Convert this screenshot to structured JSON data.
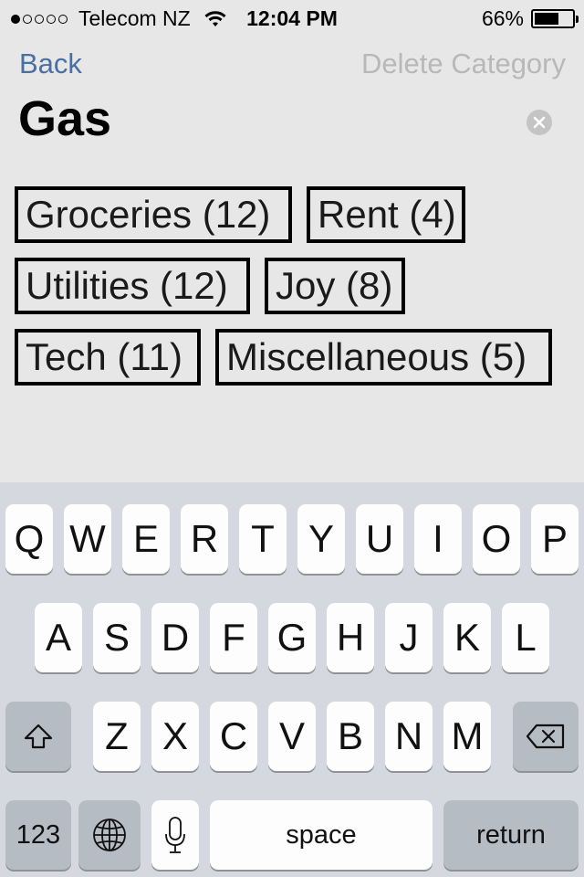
{
  "status_bar": {
    "carrier": "Telecom NZ",
    "time": "12:04 PM",
    "battery_percent": "66%",
    "battery_level": 0.66,
    "signal_bars_filled": 1,
    "signal_bars_total": 5
  },
  "nav": {
    "back_label": "Back",
    "delete_label": "Delete Category"
  },
  "category_name": {
    "value": "Gas"
  },
  "categories": [
    {
      "label": "Groceries (12)"
    },
    {
      "label": "Rent (4)"
    },
    {
      "label": "Utilities (12)"
    },
    {
      "label": "Joy (8)"
    },
    {
      "label": "Tech (11)"
    },
    {
      "label": "Miscellaneous (5)"
    }
  ],
  "keyboard": {
    "row1": [
      "Q",
      "W",
      "E",
      "R",
      "T",
      "Y",
      "U",
      "I",
      "O",
      "P"
    ],
    "row2": [
      "A",
      "S",
      "D",
      "F",
      "G",
      "H",
      "J",
      "K",
      "L"
    ],
    "row3": [
      "Z",
      "X",
      "C",
      "V",
      "B",
      "N",
      "M"
    ],
    "numbers_label": "123",
    "space_label": "space",
    "return_label": "return"
  },
  "colors": {
    "background": "#e7e7e7",
    "back_link": "#4a6fa3",
    "delete_link": "#b8b8b8",
    "keyboard_bg": "#d5d9df"
  },
  "icons": {
    "wifi": "wifi-icon",
    "battery": "battery-icon",
    "clear": "clear-icon",
    "shift": "shift-icon",
    "backspace": "backspace-icon",
    "globe": "globe-icon",
    "microphone": "microphone-icon"
  }
}
